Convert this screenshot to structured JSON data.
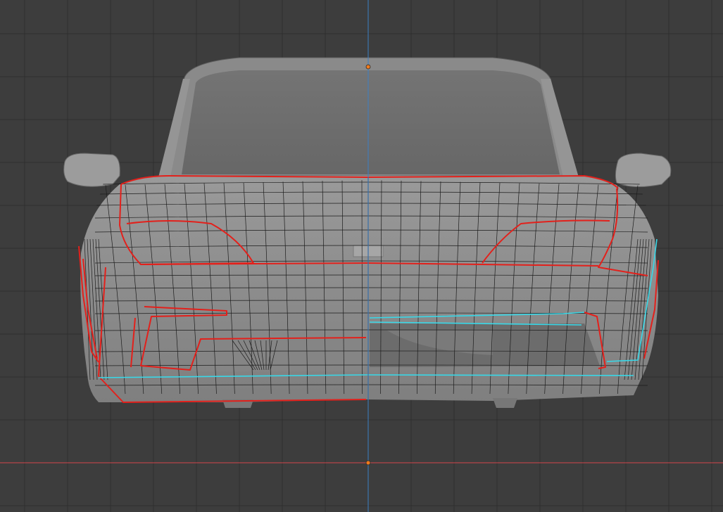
{
  "viewport": {
    "mode": "3d-viewport-orthographic-front",
    "object": "car-front-bumper-mesh",
    "colors": {
      "background": "#3d3d3d",
      "grid_minor": "#474747",
      "grid_major": "#2e2e2e",
      "axis_x": "#d2454a",
      "axis_z": "#3c7fc4",
      "mesh_fill": "#8f8f8f",
      "mesh_shadow": "#6e6e6e",
      "wireframe": "#1a1a1a",
      "seam_red": "#e3201b",
      "selected_cyan": "#38d8e8",
      "origin_point": "#f07a1c"
    },
    "icons": [
      "origin-point-icon",
      "cursor-origin-icon"
    ]
  }
}
